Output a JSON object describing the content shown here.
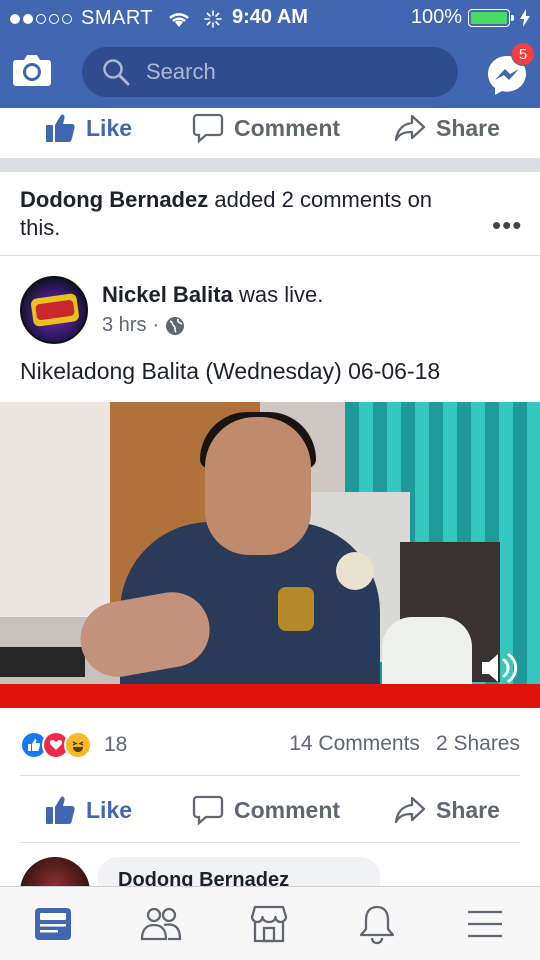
{
  "status_bar": {
    "carrier": "SMART",
    "time": "9:40 AM",
    "battery": "100%"
  },
  "header": {
    "search_placeholder": "Search",
    "messenger_badge": "5",
    "icons": [
      "camera-icon",
      "search-icon",
      "messenger-icon"
    ]
  },
  "top_actions": {
    "like": "Like",
    "comment": "Comment",
    "share": "Share"
  },
  "story": {
    "actor": "Dodong Bernadez",
    "activity": " added 2 comments on this.",
    "more": "•••"
  },
  "post": {
    "page_name": "Nickel Balita",
    "status": " was live.",
    "time": "3 hrs",
    "separator": "·",
    "text": "Nikeladong Balita (Wednesday) 06-06-18"
  },
  "stats": {
    "reactions": "18",
    "comments": "14 Comments",
    "shares": "2 Shares"
  },
  "bottom_actions": {
    "like": "Like",
    "comment": "Comment",
    "share": "Share"
  },
  "comment": {
    "author": "Dodong Bernadez"
  },
  "tabs": [
    "news-feed-icon",
    "friends-icon",
    "marketplace-icon",
    "notifications-icon",
    "menu-icon"
  ],
  "colors": {
    "brand": "#4267b2",
    "live_bar": "#e0120c",
    "battery": "#4cd964",
    "badge": "#fa3e3e"
  }
}
